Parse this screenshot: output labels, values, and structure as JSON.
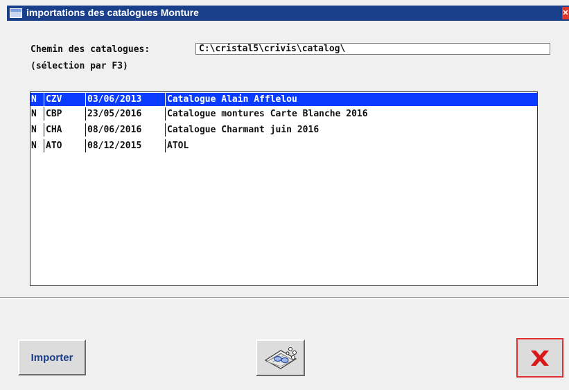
{
  "window": {
    "title": "importations des catalogues Monture",
    "close_glyph": "✕"
  },
  "path": {
    "label": "Chemin des catalogues:",
    "value": "C:\\cristal5\\crivis\\catalog\\",
    "hint": "(sélection par F3)"
  },
  "catalogs": [
    {
      "flag": "N",
      "code": "CZV",
      "date": "03/06/2013",
      "name": "Catalogue Alain Afflelou",
      "selected": true
    },
    {
      "flag": "N",
      "code": "CBP",
      "date": "23/05/2016",
      "name": "Catalogue montures Carte Blanche 2016",
      "selected": false
    },
    {
      "flag": "N",
      "code": "CHA",
      "date": "08/06/2016",
      "name": "Catalogue Charmant juin 2016",
      "selected": false
    },
    {
      "flag": "N",
      "code": "ATO",
      "date": "08/12/2015",
      "name": "ATOL",
      "selected": false
    }
  ],
  "buttons": {
    "import_label": "Importer",
    "catalog_icon": "catalog-glasses-icon",
    "close_icon": "close-icon"
  },
  "colors": {
    "title_bar": "#1a3f8a",
    "selection": "#0a3cff",
    "close_red": "#e23030"
  }
}
